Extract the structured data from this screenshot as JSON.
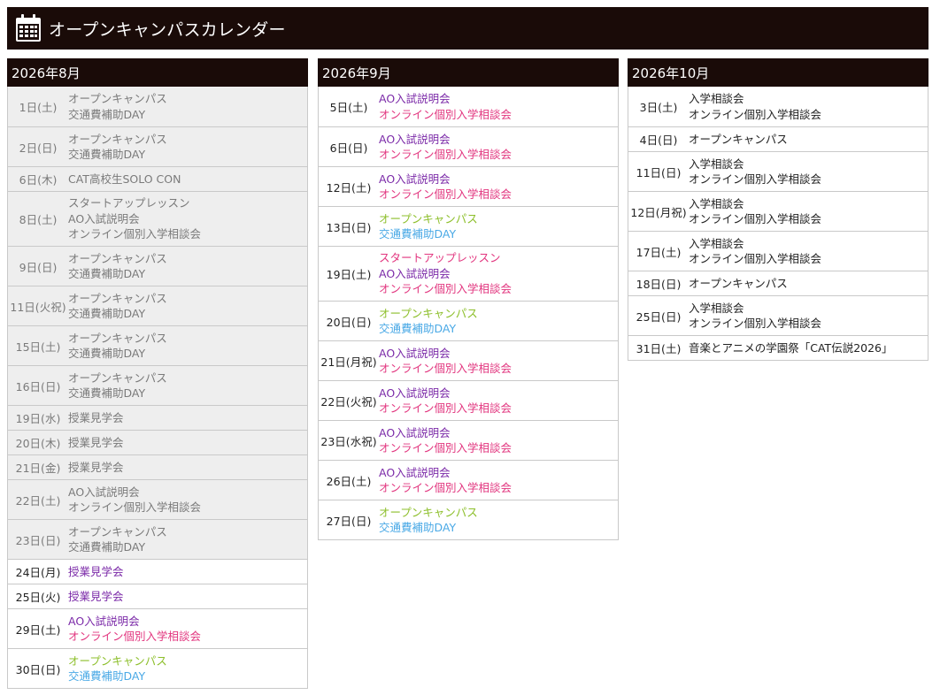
{
  "header": {
    "title": "オープンキャンパスカレンダー",
    "icon": "calendar-icon"
  },
  "colors": {
    "header_bg": "#1a0b08",
    "past_bg": "#eeeeee",
    "past_text": "#7a7a7a",
    "ao": "#7b2aa8",
    "online": "#e2367f",
    "opencampus": "#8dbf2b",
    "transport": "#4aa9e6",
    "default": "#222222"
  },
  "months": [
    {
      "title": "2026年8月",
      "rows": [
        {
          "date": "1日(土)",
          "past": true,
          "events": [
            {
              "text": "オープンキャンパス",
              "type": "default"
            },
            {
              "text": "交通費補助DAY",
              "type": "default"
            }
          ]
        },
        {
          "date": "2日(日)",
          "past": true,
          "events": [
            {
              "text": "オープンキャンパス",
              "type": "default"
            },
            {
              "text": "交通費補助DAY",
              "type": "default"
            }
          ]
        },
        {
          "date": "6日(木)",
          "past": true,
          "events": [
            {
              "text": "CAT高校生SOLO CON",
              "type": "default"
            }
          ]
        },
        {
          "date": "8日(土)",
          "past": true,
          "events": [
            {
              "text": "スタートアップレッスン",
              "type": "default"
            },
            {
              "text": "AO入試説明会",
              "type": "default"
            },
            {
              "text": "オンライン個別入学相談会",
              "type": "default"
            }
          ]
        },
        {
          "date": "9日(日)",
          "past": true,
          "events": [
            {
              "text": "オープンキャンパス",
              "type": "default"
            },
            {
              "text": "交通費補助DAY",
              "type": "default"
            }
          ]
        },
        {
          "date": "11日(火祝)",
          "past": true,
          "events": [
            {
              "text": "オープンキャンパス",
              "type": "default"
            },
            {
              "text": "交通費補助DAY",
              "type": "default"
            }
          ]
        },
        {
          "date": "15日(土)",
          "past": true,
          "events": [
            {
              "text": "オープンキャンパス",
              "type": "default"
            },
            {
              "text": "交通費補助DAY",
              "type": "default"
            }
          ]
        },
        {
          "date": "16日(日)",
          "past": true,
          "events": [
            {
              "text": "オープンキャンパス",
              "type": "default"
            },
            {
              "text": "交通費補助DAY",
              "type": "default"
            }
          ]
        },
        {
          "date": "19日(水)",
          "past": true,
          "events": [
            {
              "text": "授業見学会",
              "type": "default"
            }
          ]
        },
        {
          "date": "20日(木)",
          "past": true,
          "events": [
            {
              "text": "授業見学会",
              "type": "default"
            }
          ]
        },
        {
          "date": "21日(金)",
          "past": true,
          "events": [
            {
              "text": "授業見学会",
              "type": "default"
            }
          ]
        },
        {
          "date": "22日(土)",
          "past": true,
          "events": [
            {
              "text": "AO入試説明会",
              "type": "default"
            },
            {
              "text": "オンライン個別入学相談会",
              "type": "default"
            }
          ]
        },
        {
          "date": "23日(日)",
          "past": true,
          "events": [
            {
              "text": "オープンキャンパス",
              "type": "default"
            },
            {
              "text": "交通費補助DAY",
              "type": "default"
            }
          ]
        },
        {
          "date": "24日(月)",
          "past": false,
          "events": [
            {
              "text": "授業見学会",
              "type": "ao"
            }
          ]
        },
        {
          "date": "25日(火)",
          "past": false,
          "events": [
            {
              "text": "授業見学会",
              "type": "ao"
            }
          ]
        },
        {
          "date": "29日(土)",
          "past": false,
          "events": [
            {
              "text": "AO入試説明会",
              "type": "ao"
            },
            {
              "text": "オンライン個別入学相談会",
              "type": "online"
            }
          ]
        },
        {
          "date": "30日(日)",
          "past": false,
          "events": [
            {
              "text": "オープンキャンパス",
              "type": "opencampus"
            },
            {
              "text": "交通費補助DAY",
              "type": "transport"
            }
          ]
        }
      ]
    },
    {
      "title": "2026年9月",
      "rows": [
        {
          "date": "5日(土)",
          "past": false,
          "events": [
            {
              "text": "AO入試説明会",
              "type": "ao"
            },
            {
              "text": "オンライン個別入学相談会",
              "type": "online"
            }
          ]
        },
        {
          "date": "6日(日)",
          "past": false,
          "events": [
            {
              "text": "AO入試説明会",
              "type": "ao"
            },
            {
              "text": "オンライン個別入学相談会",
              "type": "online"
            }
          ]
        },
        {
          "date": "12日(土)",
          "past": false,
          "events": [
            {
              "text": "AO入試説明会",
              "type": "ao"
            },
            {
              "text": "オンライン個別入学相談会",
              "type": "online"
            }
          ]
        },
        {
          "date": "13日(日)",
          "past": false,
          "events": [
            {
              "text": "オープンキャンパス",
              "type": "opencampus"
            },
            {
              "text": "交通費補助DAY",
              "type": "transport"
            }
          ]
        },
        {
          "date": "19日(土)",
          "past": false,
          "events": [
            {
              "text": "スタートアップレッスン",
              "type": "online"
            },
            {
              "text": "AO入試説明会",
              "type": "ao"
            },
            {
              "text": "オンライン個別入学相談会",
              "type": "online"
            }
          ]
        },
        {
          "date": "20日(日)",
          "past": false,
          "events": [
            {
              "text": "オープンキャンパス",
              "type": "opencampus"
            },
            {
              "text": "交通費補助DAY",
              "type": "transport"
            }
          ]
        },
        {
          "date": "21日(月祝)",
          "past": false,
          "events": [
            {
              "text": "AO入試説明会",
              "type": "ao"
            },
            {
              "text": "オンライン個別入学相談会",
              "type": "online"
            }
          ]
        },
        {
          "date": "22日(火祝)",
          "past": false,
          "events": [
            {
              "text": "AO入試説明会",
              "type": "ao"
            },
            {
              "text": "オンライン個別入学相談会",
              "type": "online"
            }
          ]
        },
        {
          "date": "23日(水祝)",
          "past": false,
          "events": [
            {
              "text": "AO入試説明会",
              "type": "ao"
            },
            {
              "text": "オンライン個別入学相談会",
              "type": "online"
            }
          ]
        },
        {
          "date": "26日(土)",
          "past": false,
          "events": [
            {
              "text": "AO入試説明会",
              "type": "ao"
            },
            {
              "text": "オンライン個別入学相談会",
              "type": "online"
            }
          ]
        },
        {
          "date": "27日(日)",
          "past": false,
          "events": [
            {
              "text": "オープンキャンパス",
              "type": "opencampus"
            },
            {
              "text": "交通費補助DAY",
              "type": "transport"
            }
          ]
        }
      ]
    },
    {
      "title": "2026年10月",
      "rows": [
        {
          "date": "3日(土)",
          "past": false,
          "events": [
            {
              "text": "入学相談会",
              "type": "default"
            },
            {
              "text": "オンライン個別入学相談会",
              "type": "default"
            }
          ]
        },
        {
          "date": "4日(日)",
          "past": false,
          "events": [
            {
              "text": "オープンキャンパス",
              "type": "default"
            }
          ]
        },
        {
          "date": "11日(日)",
          "past": false,
          "events": [
            {
              "text": "入学相談会",
              "type": "default"
            },
            {
              "text": "オンライン個別入学相談会",
              "type": "default"
            }
          ]
        },
        {
          "date": "12日(月祝)",
          "past": false,
          "events": [
            {
              "text": "入学相談会",
              "type": "default"
            },
            {
              "text": "オンライン個別入学相談会",
              "type": "default"
            }
          ]
        },
        {
          "date": "17日(土)",
          "past": false,
          "events": [
            {
              "text": "入学相談会",
              "type": "default"
            },
            {
              "text": "オンライン個別入学相談会",
              "type": "default"
            }
          ]
        },
        {
          "date": "18日(日)",
          "past": false,
          "events": [
            {
              "text": "オープンキャンパス",
              "type": "default"
            }
          ]
        },
        {
          "date": "25日(日)",
          "past": false,
          "events": [
            {
              "text": "入学相談会",
              "type": "default"
            },
            {
              "text": "オンライン個別入学相談会",
              "type": "default"
            }
          ]
        },
        {
          "date": "31日(土)",
          "past": false,
          "events": [
            {
              "text": "音楽とアニメの学園祭「CAT伝説2026」",
              "type": "default"
            }
          ]
        }
      ]
    }
  ]
}
